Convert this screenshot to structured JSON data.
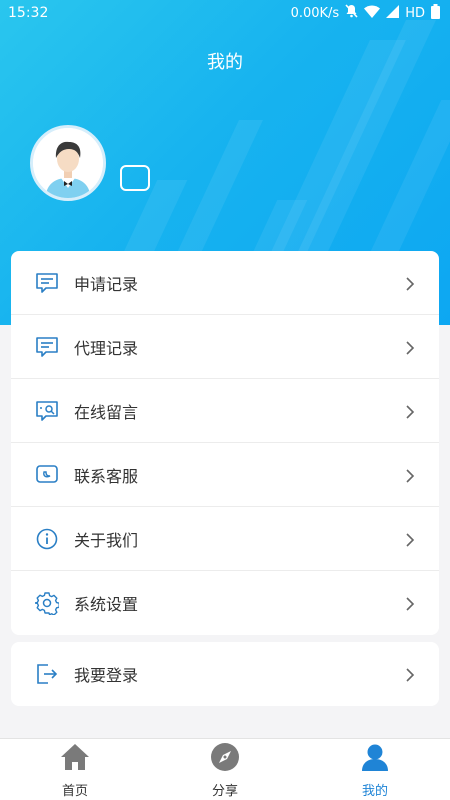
{
  "status": {
    "time": "15:32",
    "speed": "0.00K/s",
    "network": "HD"
  },
  "header": {
    "title": "我的"
  },
  "menu": [
    {
      "label": "申请记录",
      "icon": "message-lines-icon"
    },
    {
      "label": "代理记录",
      "icon": "message-lines-icon"
    },
    {
      "label": "在线留言",
      "icon": "message-search-icon"
    },
    {
      "label": "联系客服",
      "icon": "chat-bubble-icon"
    },
    {
      "label": "关于我们",
      "icon": "info-icon"
    },
    {
      "label": "系统设置",
      "icon": "gear-icon"
    }
  ],
  "login": {
    "label": "我要登录",
    "icon": "logout-arrow-icon"
  },
  "tabs": [
    {
      "label": "首页",
      "icon": "home-icon"
    },
    {
      "label": "分享",
      "icon": "compass-icon"
    },
    {
      "label": "我的",
      "icon": "user-icon",
      "active": true
    }
  ],
  "colors": {
    "header_gradient": [
      "#2ac6ee",
      "#0da7f2"
    ],
    "accent": "#1f84d6",
    "icon": "#2a7fc5"
  }
}
